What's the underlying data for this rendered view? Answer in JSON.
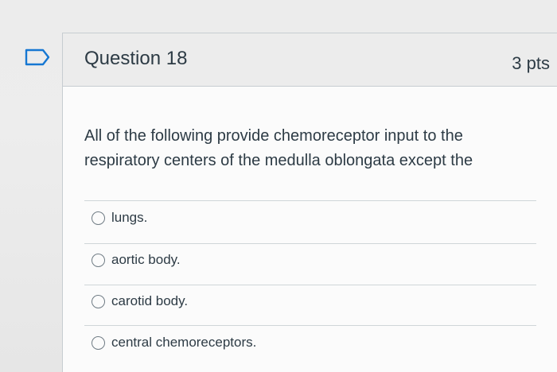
{
  "question": {
    "title": "Question 18",
    "points": "3 pts",
    "text": "All of the following provide chemoreceptor input to the respiratory centers of the medulla oblongata except the",
    "bookmark_icon": "bookmark-flag-icon",
    "answers": [
      {
        "label": "lungs.",
        "selected": false
      },
      {
        "label": "aortic body.",
        "selected": false
      },
      {
        "label": "carotid body.",
        "selected": false
      },
      {
        "label": "central chemoreceptors.",
        "selected": false
      }
    ]
  },
  "colors": {
    "text": "#2d3b45",
    "header_bg": "#ececec",
    "card_bg": "#fbfbfb",
    "border": "#c7cdd1"
  }
}
